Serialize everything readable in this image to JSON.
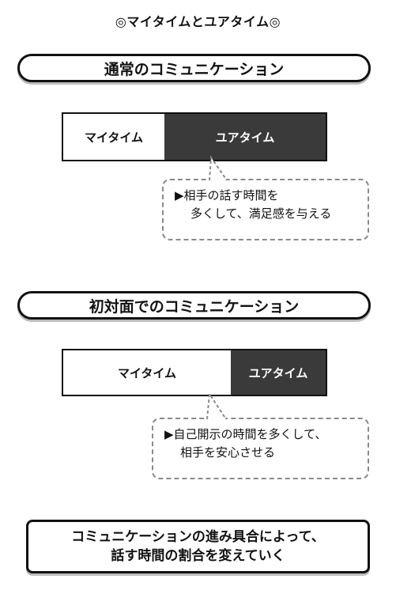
{
  "title": "◎マイタイムとユアタイム◎",
  "sections": [
    {
      "heading": "通常のコミュニケーション",
      "bar": {
        "my_label": "マイタイム",
        "your_label": "ユアタイム"
      },
      "note": {
        "line1": "相手の話す時間を",
        "line2": "多くして、満足感を与える"
      }
    },
    {
      "heading": "初対面でのコミュニケーション",
      "bar": {
        "my_label": "マイタイム",
        "your_label": "ユアタイム"
      },
      "note": {
        "line1": "自己開示の時間を多くして、",
        "line2": "相手を安心させる"
      }
    }
  ],
  "marker": "▶",
  "summary": {
    "line1": "コミュニケーションの進み具合によって、",
    "line2": "話す時間の割合を変えていく"
  }
}
